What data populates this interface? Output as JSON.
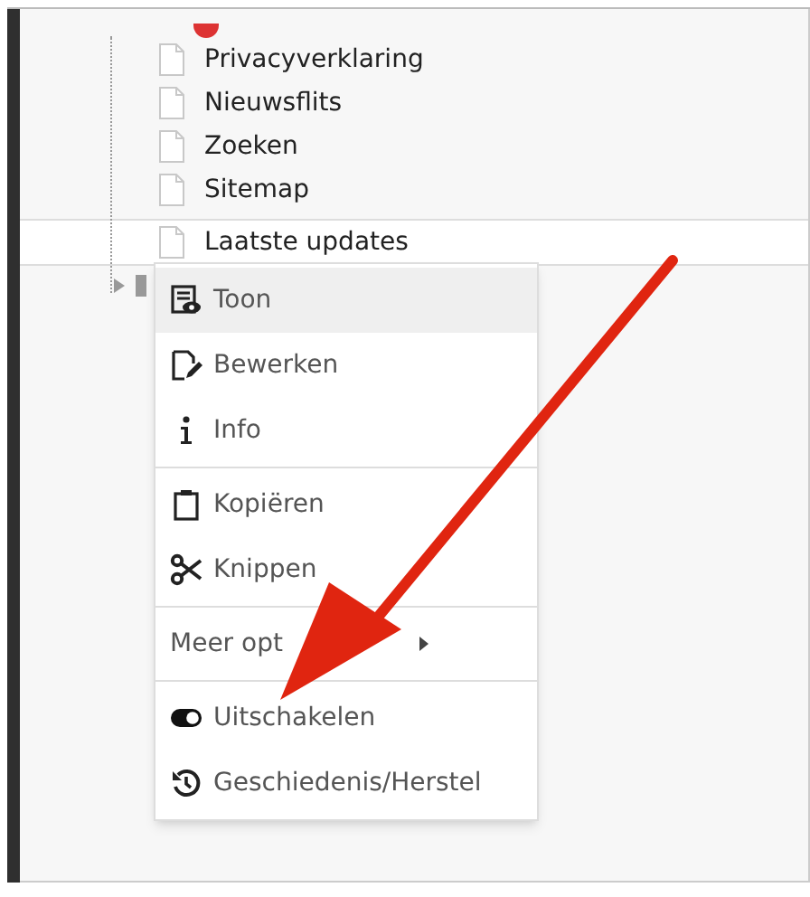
{
  "tree": {
    "items": [
      {
        "label": "Privacyverklaring",
        "selected": false
      },
      {
        "label": "Nieuwsflits",
        "selected": false
      },
      {
        "label": "Zoeken",
        "selected": false
      },
      {
        "label": "Sitemap",
        "selected": false
      },
      {
        "label": "Laatste updates",
        "selected": true
      }
    ]
  },
  "context_menu": {
    "groups": [
      [
        {
          "label": "Toon",
          "kind": "view",
          "hovered": true
        },
        {
          "label": "Bewerken",
          "kind": "edit",
          "hovered": false
        },
        {
          "label": "Info",
          "kind": "info",
          "hovered": false
        }
      ],
      [
        {
          "label": "Kopiëren",
          "kind": "copy",
          "hovered": false
        },
        {
          "label": "Knippen",
          "kind": "cut",
          "hovered": false
        }
      ],
      [
        {
          "label": "Meer opt",
          "kind": "submenu",
          "hovered": false
        }
      ],
      [
        {
          "label": "Uitschakelen",
          "kind": "toggle",
          "hovered": false
        },
        {
          "label": "Geschiedenis/Herstel",
          "kind": "history",
          "hovered": false
        }
      ]
    ]
  }
}
